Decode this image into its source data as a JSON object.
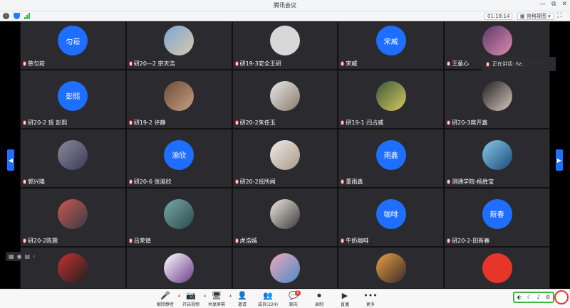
{
  "window": {
    "title": "腾讯会议",
    "controls": [
      "—",
      "⧉",
      "✕"
    ]
  },
  "infobar": {
    "timer": "01:18:14",
    "view_label": "宫格视图"
  },
  "speaking": {
    "text": "正在讲话: hz;"
  },
  "colors": {
    "blue_avatar": "#1e6fff",
    "tile_bg": "#2b2b2f",
    "accent": "#1e6fff",
    "tray_border": "#3db83d"
  },
  "tiles": [
    {
      "name": "慈匀菘",
      "avatar_text": "匀菘",
      "style": "blue"
    },
    {
      "name": "研20—2 宗天浩",
      "avatar_text": "",
      "style": "photo1"
    },
    {
      "name": "研19-3安全王研",
      "avatar_text": "",
      "style": "default"
    },
    {
      "name": "宋威",
      "avatar_text": "宋威",
      "style": "blue"
    },
    {
      "name": "王童心",
      "avatar_text": "",
      "style": "photo2"
    },
    {
      "name": "研20-2 班 彭熙",
      "avatar_text": "彭熙",
      "style": "blue"
    },
    {
      "name": "研19-2 许静",
      "avatar_text": "",
      "style": "photo3"
    },
    {
      "name": "研20-2朱任玉",
      "avatar_text": "",
      "style": "photo4"
    },
    {
      "name": "研19-1 闫占威",
      "avatar_text": "",
      "style": "photo5"
    },
    {
      "name": "研20-3席开鑫",
      "avatar_text": "",
      "style": "photo6"
    },
    {
      "name": "郭兴隆",
      "avatar_text": "",
      "style": "photo7"
    },
    {
      "name": "研20-6 张渝欣",
      "avatar_text": "渝欣",
      "style": "blue"
    },
    {
      "name": "研20-2班所闻",
      "avatar_text": "",
      "style": "photo8"
    },
    {
      "name": "董雨鑫",
      "avatar_text": "雨鑫",
      "style": "blue"
    },
    {
      "name": "测通学院-杨胜宝",
      "avatar_text": "",
      "style": "photo9"
    },
    {
      "name": "研20-2陈震",
      "avatar_text": "",
      "style": "photo10"
    },
    {
      "name": "吕荣镇",
      "avatar_text": "",
      "style": "photo11"
    },
    {
      "name": "虎浩嫣",
      "avatar_text": "",
      "style": "photo12"
    },
    {
      "name": "牛奶咖啡",
      "avatar_text": "咖啡",
      "style": "blue"
    },
    {
      "name": "研20-2-田新春",
      "avatar_text": "新春",
      "style": "blue"
    },
    {
      "name": "",
      "avatar_text": "",
      "style": "photo13"
    },
    {
      "name": "",
      "avatar_text": "",
      "style": "photo14"
    },
    {
      "name": "",
      "avatar_text": "",
      "style": "photo15"
    },
    {
      "name": "",
      "avatar_text": "",
      "style": "photo16"
    },
    {
      "name": "",
      "avatar_text": "",
      "style": "photo17"
    }
  ],
  "toolbar": [
    {
      "label": "解除静音",
      "glyph": "🎤",
      "caret": true,
      "icon": "mic-muted-icon"
    },
    {
      "label": "开启视频",
      "glyph": "📷",
      "caret": true,
      "icon": "camera-off-icon"
    },
    {
      "label": "共享屏幕",
      "glyph": "🖥",
      "caret": true,
      "icon": "share-screen-icon"
    },
    {
      "label": "邀请",
      "glyph": "👤",
      "caret": false,
      "icon": "invite-icon"
    },
    {
      "label": "成员(224)",
      "glyph": "👥",
      "caret": false,
      "icon": "members-icon"
    },
    {
      "label": "聊天",
      "glyph": "💬",
      "caret": false,
      "icon": "chat-icon",
      "badge": "5"
    },
    {
      "label": "录制",
      "glyph": "⏺",
      "caret": false,
      "icon": "record-icon"
    },
    {
      "label": "直播",
      "glyph": "▶",
      "caret": false,
      "icon": "live-icon"
    },
    {
      "label": "更多",
      "glyph": "•••",
      "caret": false,
      "icon": "more-icon"
    }
  ]
}
